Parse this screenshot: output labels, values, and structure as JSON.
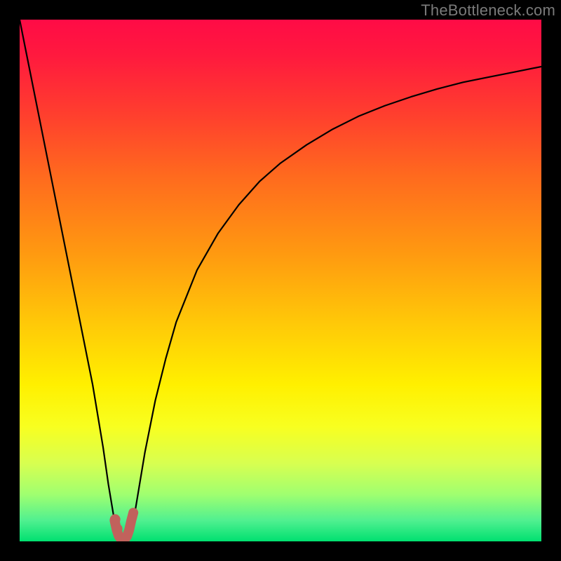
{
  "watermark": "TheBottleneck.com",
  "chart_data": {
    "type": "line",
    "title": "",
    "xlabel": "",
    "ylabel": "",
    "xlim": [
      0,
      100
    ],
    "ylim": [
      0,
      100
    ],
    "grid": false,
    "legend": false,
    "background_gradient": {
      "stops": [
        {
          "offset": 0.0,
          "color": "#ff0b46"
        },
        {
          "offset": 0.07,
          "color": "#ff1a3e"
        },
        {
          "offset": 0.18,
          "color": "#ff3e2e"
        },
        {
          "offset": 0.3,
          "color": "#ff6a1e"
        },
        {
          "offset": 0.45,
          "color": "#ff9a10"
        },
        {
          "offset": 0.58,
          "color": "#ffc808"
        },
        {
          "offset": 0.7,
          "color": "#fff000"
        },
        {
          "offset": 0.78,
          "color": "#f8ff20"
        },
        {
          "offset": 0.85,
          "color": "#d8ff50"
        },
        {
          "offset": 0.91,
          "color": "#a0ff70"
        },
        {
          "offset": 0.96,
          "color": "#50f090"
        },
        {
          "offset": 1.0,
          "color": "#00e070"
        }
      ]
    },
    "series": [
      {
        "name": "bottleneck-curve",
        "color": "#000000",
        "width": 2.2,
        "x": [
          0.0,
          2.0,
          4.0,
          6.0,
          8.0,
          10.0,
          12.0,
          14.0,
          16.0,
          17.0,
          18.0,
          19.0,
          19.6,
          20.4,
          21.0,
          22.0,
          23.0,
          24.0,
          26.0,
          28.0,
          30.0,
          34.0,
          38.0,
          42.0,
          46.0,
          50.0,
          55.0,
          60.0,
          65.0,
          70.0,
          75.0,
          80.0,
          85.0,
          90.0,
          95.0,
          100.0
        ],
        "y": [
          100.0,
          90.0,
          80.0,
          70.0,
          60.0,
          50.0,
          40.0,
          30.0,
          18.0,
          11.0,
          5.0,
          1.5,
          0.5,
          0.5,
          1.5,
          5.0,
          11.0,
          17.0,
          27.0,
          35.0,
          42.0,
          52.0,
          59.0,
          64.5,
          69.0,
          72.5,
          76.0,
          79.0,
          81.5,
          83.5,
          85.2,
          86.7,
          88.0,
          89.0,
          90.0,
          91.0
        ]
      }
    ],
    "valley_marker": {
      "name": "optimal-region",
      "color": "#c1625c",
      "width": 14,
      "x": [
        18.2,
        18.6,
        19.0,
        19.4,
        19.8,
        20.2,
        20.6,
        21.0,
        21.4,
        21.8
      ],
      "y": [
        4.0,
        2.2,
        1.0,
        0.5,
        0.5,
        0.5,
        1.0,
        2.2,
        4.0,
        5.5
      ]
    }
  }
}
